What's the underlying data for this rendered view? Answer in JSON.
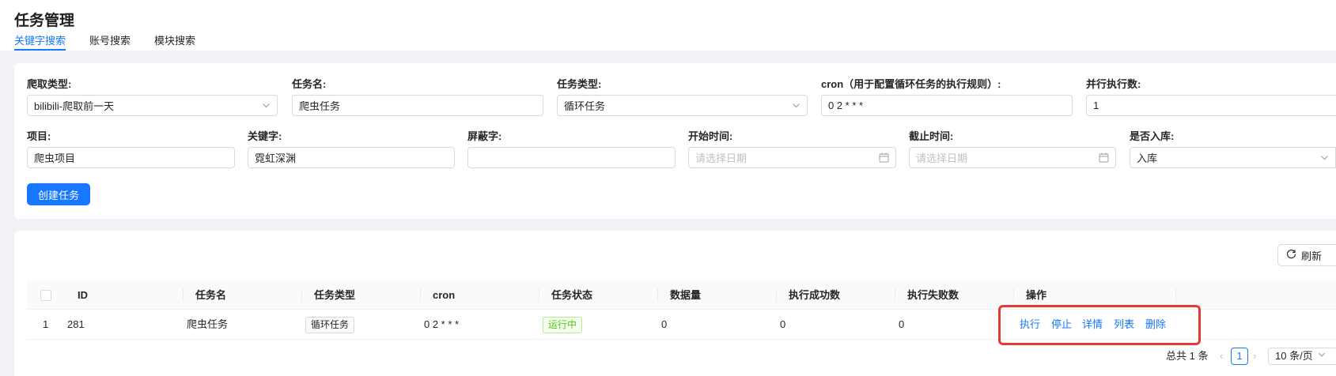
{
  "page": {
    "title": "任务管理"
  },
  "tabs": [
    {
      "label": "关键字搜索",
      "active": true
    },
    {
      "label": "账号搜索",
      "active": false
    },
    {
      "label": "模块搜索",
      "active": false
    }
  ],
  "form": {
    "crawl_type": {
      "label": "爬取类型:",
      "value": "bilibili-爬取前一天"
    },
    "task_name": {
      "label": "任务名:",
      "value": "爬虫任务"
    },
    "task_type": {
      "label": "任务类型:",
      "value": "循环任务"
    },
    "cron": {
      "label": "cron（用于配置循环任务的执行规则）:",
      "value": "0 2 * * *"
    },
    "concurrency": {
      "label": "并行执行数:",
      "value": "1"
    },
    "project": {
      "label": "项目:",
      "value": "爬虫项目"
    },
    "keyword": {
      "label": "关键字:",
      "value": "霓虹深渊"
    },
    "blocked_words": {
      "label": "屏蔽字:",
      "value": ""
    },
    "start_time": {
      "label": "开始时间:",
      "placeholder": "请选择日期"
    },
    "end_time": {
      "label": "截止时间:",
      "placeholder": "请选择日期"
    },
    "store": {
      "label": "是否入库:",
      "value": "入库"
    },
    "create_button": "创建任务"
  },
  "toolbar": {
    "refresh_label": "刷新"
  },
  "table": {
    "columns": [
      "ID",
      "任务名",
      "任务类型",
      "cron",
      "任务状态",
      "数据量",
      "执行成功数",
      "执行失败数",
      "操作"
    ],
    "rows": [
      {
        "index": "1",
        "id": "281",
        "name": "爬虫任务",
        "type": "循环任务",
        "cron": "0 2 * * *",
        "status": "运行中",
        "data_count": "0",
        "success_count": "0",
        "fail_count": "0",
        "actions": [
          "执行",
          "停止",
          "详情",
          "列表",
          "删除"
        ]
      }
    ]
  },
  "pagination": {
    "total": "总共 1 条",
    "current_page": "1",
    "page_size": "10 条/页"
  },
  "colors": {
    "primary": "#1677ff",
    "success": "#52c41a",
    "highlight": "#e53935"
  }
}
